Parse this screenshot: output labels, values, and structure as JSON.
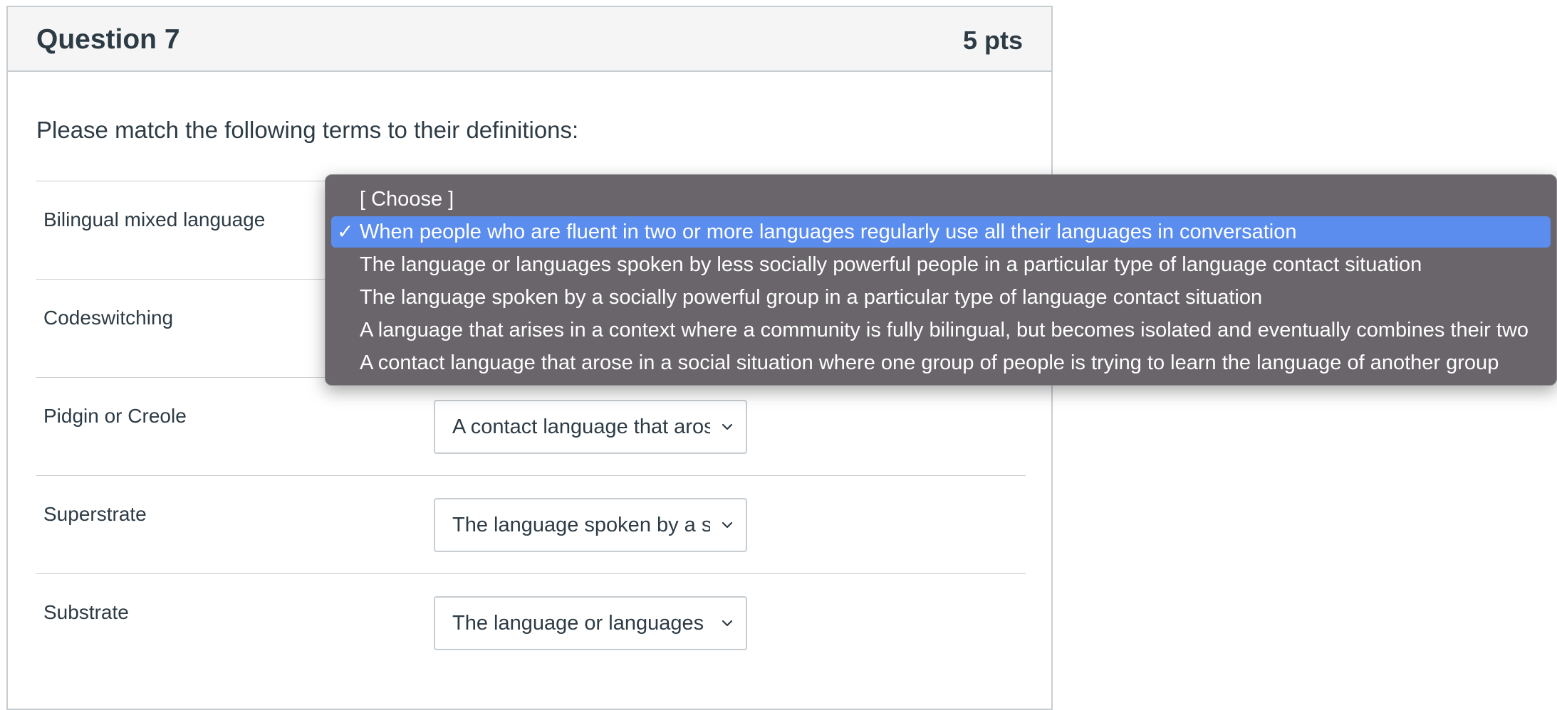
{
  "question": {
    "title": "Question 7",
    "points": "5 pts",
    "prompt": "Please match the following terms to their definitions:"
  },
  "rows": [
    {
      "term": "Bilingual mixed language",
      "selected": "When people who are fluent in two or more languages regularly use all their languages in conversation"
    },
    {
      "term": "Codeswitching",
      "selected": ""
    },
    {
      "term": "Pidgin or Creole",
      "selected": "A contact language that arose in a social situation where one group of people is trying to learn the language of another group"
    },
    {
      "term": "Superstrate",
      "selected": "The language spoken by a socially powerful group in a particular type of language contact situation"
    },
    {
      "term": "Substrate",
      "selected": "The language or languages spoken by less socially powerful people in a particular type of language contact situation"
    }
  ],
  "dropdown": {
    "check_mark": "✓",
    "options": [
      {
        "label": "[ Choose ]",
        "selected": false
      },
      {
        "label": "When people who are fluent in two or more languages regularly use all their languages in conversation",
        "selected": true
      },
      {
        "label": "The language or languages spoken by less socially powerful people in a particular type of language contact situation",
        "selected": false
      },
      {
        "label": "The language spoken by a socially powerful group in a particular type of language contact situation",
        "selected": false
      },
      {
        "label": "A language that arises in a context where a community is fully bilingual, but becomes isolated and eventually combines their two",
        "selected": false
      },
      {
        "label": "A contact language that arose in a social situation where one group of people is trying to learn the language of another group",
        "selected": false
      }
    ]
  },
  "colors": {
    "header_bg": "#f5f5f5",
    "border": "#c7cdd1",
    "text": "#2d3b45",
    "menu_bg": "#69656a",
    "menu_highlight": "#5b8def"
  },
  "icons": {
    "select_arrow": "chevron-down-icon",
    "selected_mark": "checkmark-icon"
  }
}
